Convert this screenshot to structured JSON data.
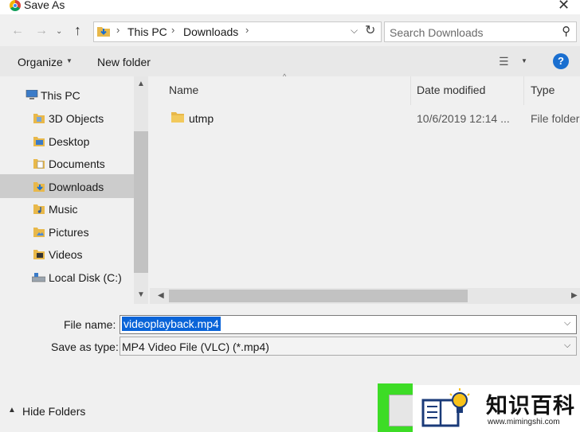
{
  "window": {
    "title": "Save As"
  },
  "address": {
    "crumbs": [
      "This PC",
      "Downloads"
    ],
    "search_placeholder": "Search Downloads"
  },
  "toolbar": {
    "organize": "Organize",
    "new_folder": "New folder"
  },
  "nav": {
    "items": [
      {
        "label": "This PC",
        "icon": "computer-icon"
      },
      {
        "label": "3D Objects",
        "icon": "cube-folder-icon"
      },
      {
        "label": "Desktop",
        "icon": "desktop-folder-icon"
      },
      {
        "label": "Documents",
        "icon": "documents-folder-icon"
      },
      {
        "label": "Downloads",
        "icon": "download-folder-icon",
        "selected": true
      },
      {
        "label": "Music",
        "icon": "music-folder-icon"
      },
      {
        "label": "Pictures",
        "icon": "pictures-folder-icon"
      },
      {
        "label": "Videos",
        "icon": "videos-folder-icon"
      },
      {
        "label": "Local Disk (C:)",
        "icon": "drive-icon"
      }
    ]
  },
  "files": {
    "columns": [
      "Name",
      "Date modified",
      "Type"
    ],
    "rows": [
      {
        "name": "utmp",
        "date": "10/6/2019 12:14 ...",
        "type": "File folder"
      }
    ]
  },
  "form": {
    "file_name_label": "File name:",
    "file_name_value": "videoplayback.mp4",
    "type_label": "Save as type:",
    "type_value": "MP4 Video File (VLC) (*.mp4)",
    "hide_folders": "Hide Folders"
  },
  "watermark": {
    "title": "知识百科",
    "url": "www.mimingshi.com"
  },
  "colors": {
    "selection": "#0a64d8",
    "highlight": "#3ddc26",
    "help": "#1a6fd0"
  }
}
